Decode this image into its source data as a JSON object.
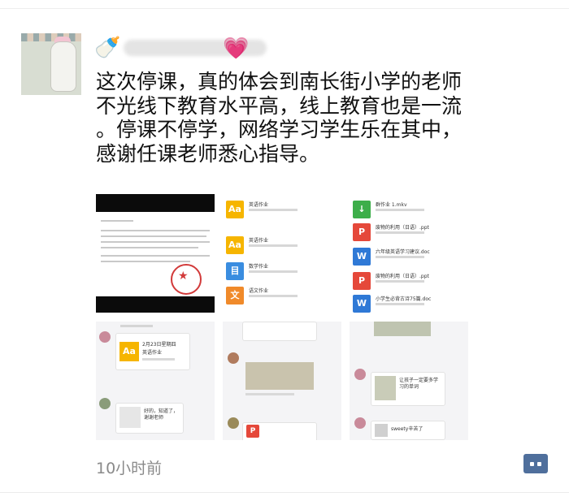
{
  "post": {
    "author_icon": "baby-bottle-icon",
    "author_badge_icon": "heart-icon",
    "text_lines": [
      "这次停课，真的体会到南长街小学的老师",
      "不光线下教育水平高，线上教育也是一流",
      "。停课不停学，网络学习学生乐在其中，",
      "感谢任课老师悉心指导。"
    ],
    "timestamp": "10小时前",
    "comment_icon": "comment-more-icon"
  },
  "images": {
    "cell2": {
      "items": [
        {
          "icon": "Aa",
          "label": "英语作业",
          "color": "#f6b500"
        },
        {
          "icon": "Aa",
          "label": "英语作业",
          "color": "#f6b500"
        },
        {
          "icon": "目",
          "label": "数学作业",
          "color": "#3a8de0"
        },
        {
          "icon": "文",
          "label": "语文作业",
          "color": "#f08a2a"
        }
      ]
    },
    "cell3": {
      "items": [
        {
          "icon": "↓",
          "label": "群作业 1.mkv",
          "color": "#3dae4a"
        },
        {
          "icon": "P",
          "label": "废物的利用（日语）.ppt",
          "color": "#e5483a"
        },
        {
          "icon": "W",
          "label": "六年级英语学习建议.doc",
          "color": "#2f79d6"
        },
        {
          "icon": "P",
          "label": "废物的利用（日语）.ppt",
          "color": "#e5483a"
        },
        {
          "icon": "W",
          "label": "小学生必背古诗75篇.doc",
          "color": "#2f79d6"
        }
      ]
    },
    "cell4": {
      "card_title": "2月23日星期四",
      "card_sub": "英语作业",
      "reply": "好的，知道了，谢谢老师"
    },
    "cell6": {
      "reply1": "让孩子一定要多学习的单词",
      "reply2": "sweety辛苦了"
    }
  }
}
